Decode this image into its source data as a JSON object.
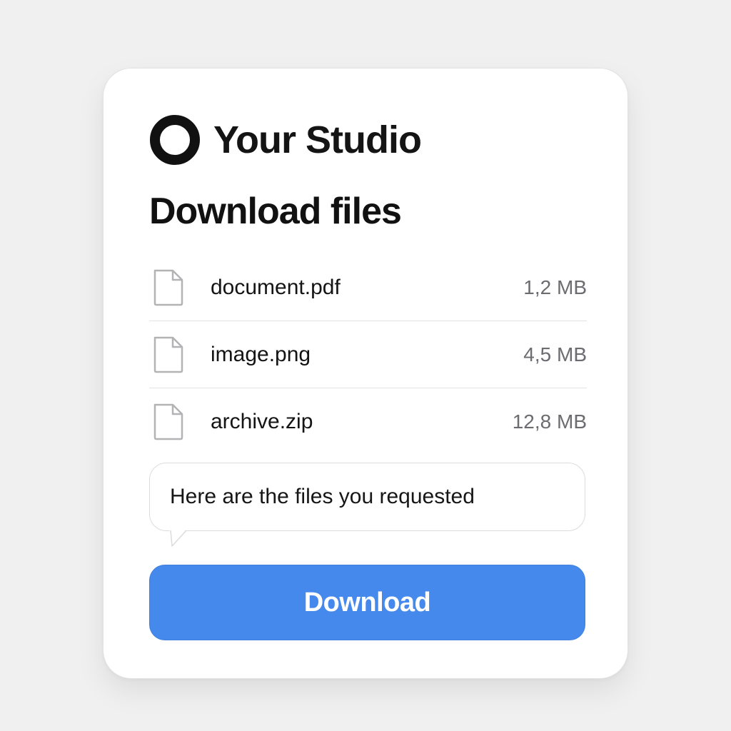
{
  "brand": {
    "name": "Your Studio",
    "logo_icon": "ring-logo-icon"
  },
  "page": {
    "title": "Download files"
  },
  "files": [
    {
      "name": "document.pdf",
      "size": "1,2 MB",
      "icon": "file-icon"
    },
    {
      "name": "image.png",
      "size": "4,5 MB",
      "icon": "file-icon"
    },
    {
      "name": "archive.zip",
      "size": "12,8 MB",
      "icon": "file-icon"
    }
  ],
  "message": {
    "text": "Here are the files you requested"
  },
  "actions": {
    "download_label": "Download"
  },
  "colors": {
    "accent": "#4589ec",
    "background": "#f0f0f1",
    "card": "#ffffff",
    "text": "#141414",
    "muted": "#6c6c70"
  }
}
